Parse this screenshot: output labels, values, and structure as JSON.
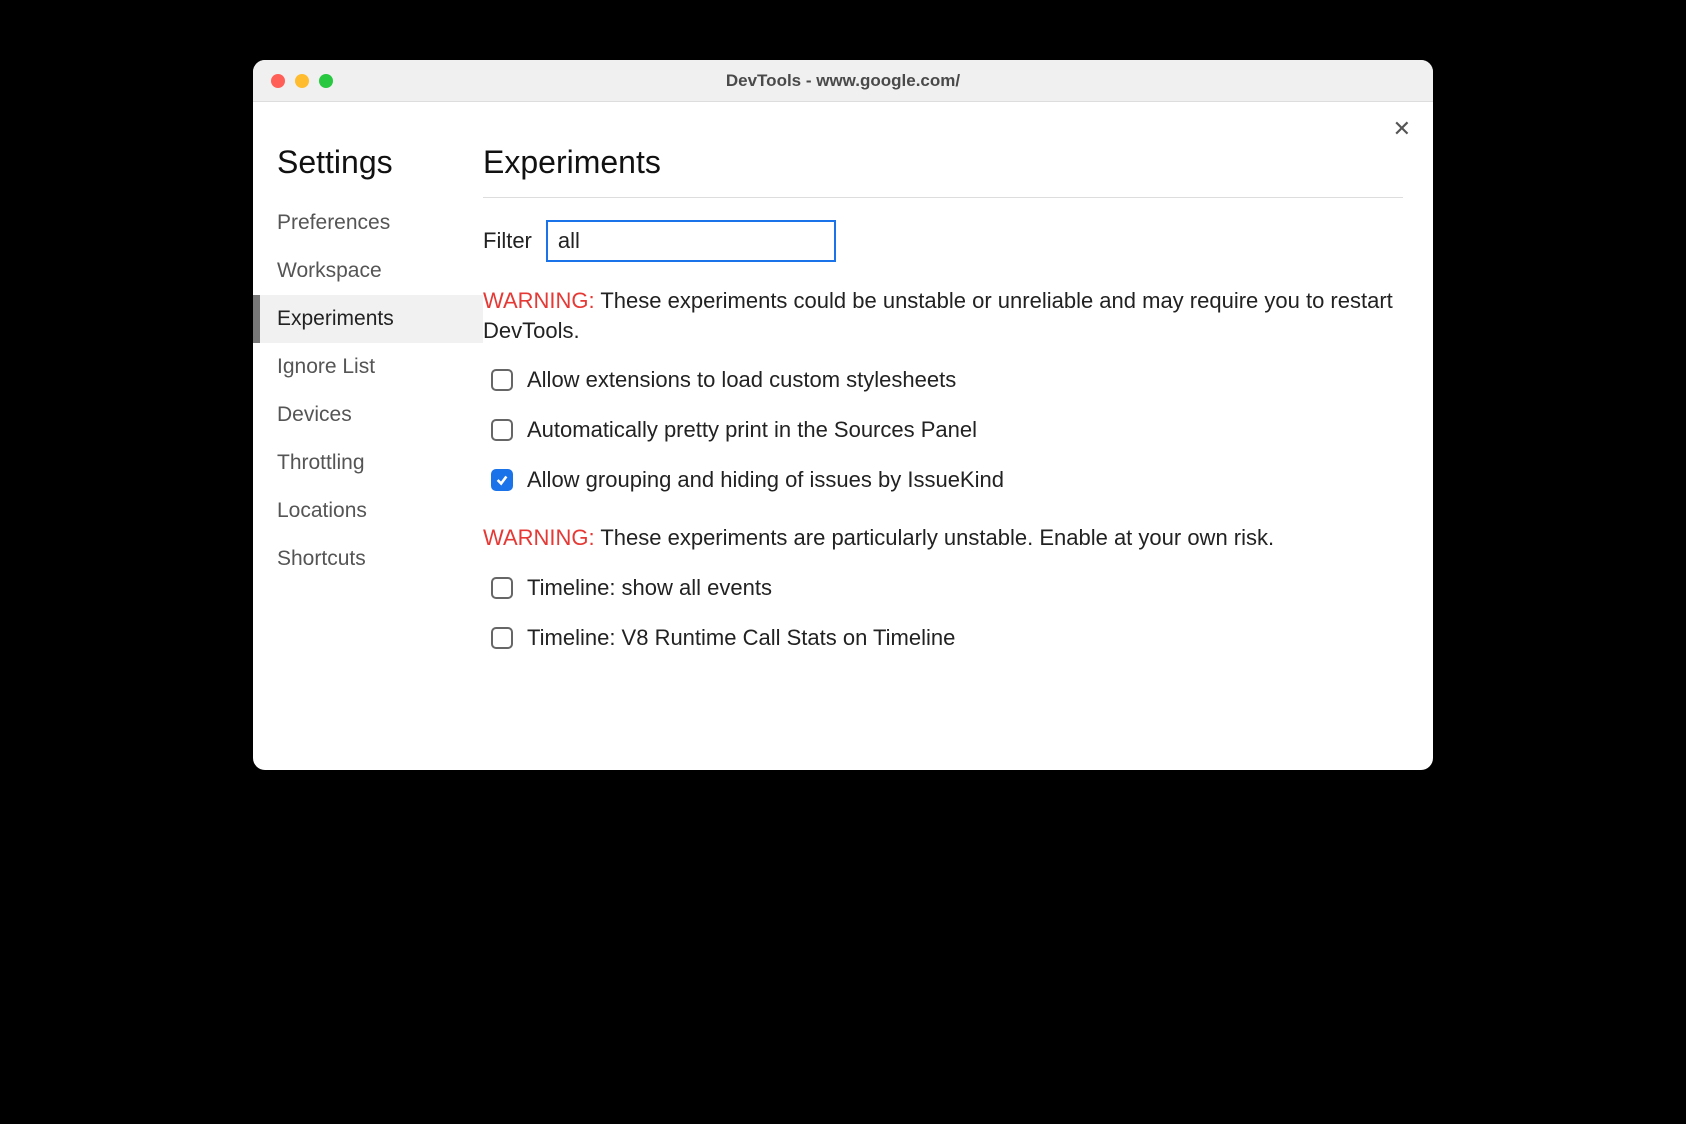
{
  "window": {
    "title": "DevTools - www.google.com/"
  },
  "sidebar": {
    "title": "Settings",
    "items": [
      {
        "label": "Preferences",
        "active": false
      },
      {
        "label": "Workspace",
        "active": false
      },
      {
        "label": "Experiments",
        "active": true
      },
      {
        "label": "Ignore List",
        "active": false
      },
      {
        "label": "Devices",
        "active": false
      },
      {
        "label": "Throttling",
        "active": false
      },
      {
        "label": "Locations",
        "active": false
      },
      {
        "label": "Shortcuts",
        "active": false
      }
    ]
  },
  "main": {
    "title": "Experiments",
    "filter_label": "Filter",
    "filter_value": "all",
    "warning1_prefix": "WARNING:",
    "warning1_text": " These experiments could be unstable or unreliable and may require you to restart DevTools.",
    "warning2_prefix": "WARNING:",
    "warning2_text": " These experiments are particularly unstable. Enable at your own risk.",
    "group1": [
      {
        "label": "Allow extensions to load custom stylesheets",
        "checked": false
      },
      {
        "label": "Automatically pretty print in the Sources Panel",
        "checked": false
      },
      {
        "label": "Allow grouping and hiding of issues by IssueKind",
        "checked": true
      }
    ],
    "group2": [
      {
        "label": "Timeline: show all events",
        "checked": false
      },
      {
        "label": "Timeline: V8 Runtime Call Stats on Timeline",
        "checked": false
      }
    ]
  }
}
